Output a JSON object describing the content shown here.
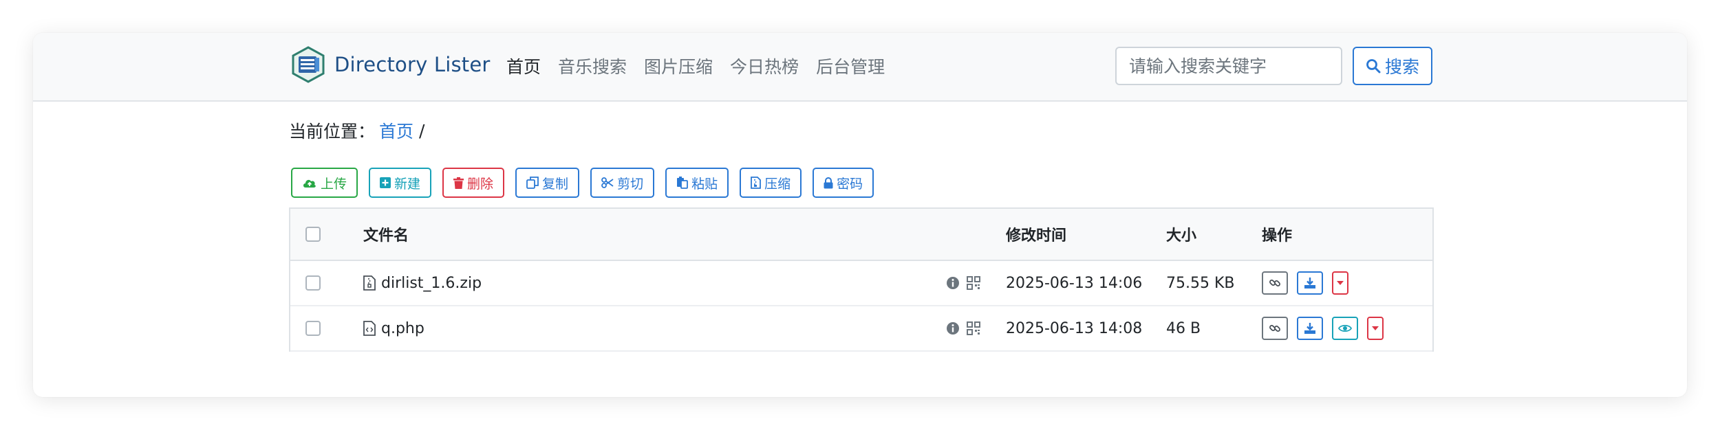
{
  "brand": {
    "name": "Directory Lister"
  },
  "nav": {
    "items": [
      {
        "label": "首页",
        "active": true
      },
      {
        "label": "音乐搜索"
      },
      {
        "label": "图片压缩"
      },
      {
        "label": "今日热榜"
      },
      {
        "label": "后台管理"
      }
    ]
  },
  "search": {
    "placeholder": "请输入搜索关键字",
    "value": "",
    "button_label": "搜索"
  },
  "breadcrumb": {
    "prefix": "当前位置：",
    "home": "首页",
    "separator": "/"
  },
  "toolbar": {
    "upload": "上传",
    "new": "新建",
    "delete": "删除",
    "copy": "复制",
    "cut": "剪切",
    "paste": "粘贴",
    "compress": "压缩",
    "password": "密码"
  },
  "table": {
    "headers": {
      "name": "文件名",
      "modified": "修改时间",
      "size": "大小",
      "actions": "操作"
    },
    "rows": [
      {
        "name": "dirlist_1.6.zip",
        "icon": "file-zip-icon",
        "modified": "2025-06-13 14:06",
        "size": "75.55 KB"
      },
      {
        "name": "q.php",
        "icon": "file-code-icon",
        "modified": "2025-06-13 14:08",
        "size": "46 B"
      }
    ]
  },
  "colors": {
    "primary": "#2a78d4",
    "success": "#28a745",
    "info": "#17a2b8",
    "danger": "#dc3545",
    "brand": "#1e4f86"
  }
}
